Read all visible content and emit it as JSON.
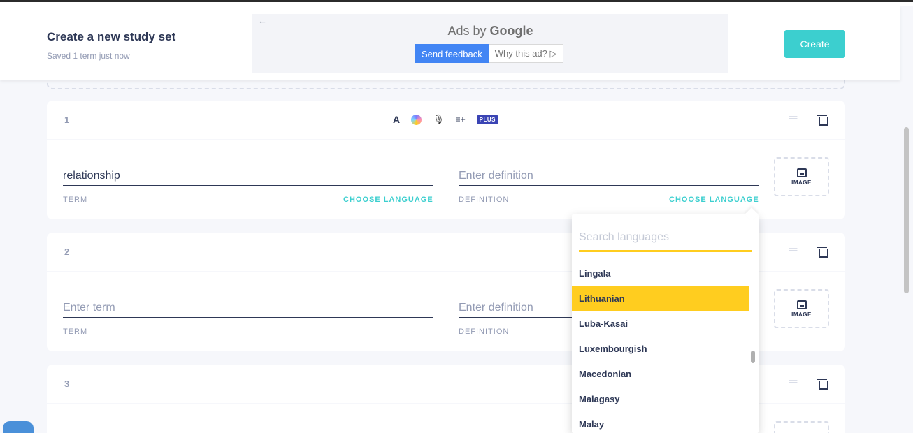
{
  "header": {
    "title": "Create a new study set",
    "saved_status": "Saved 1 term just now",
    "create_label": "Create"
  },
  "ad": {
    "back_arrow": "←",
    "title_prefix": "Ads by ",
    "title_brand": "Google",
    "feedback_label": "Send feedback",
    "why_label": "Why this ad? ▷"
  },
  "toolbar": {
    "text_icon": "A",
    "mic_icon": "🎙",
    "list_icon": "≡+",
    "plus_badge": "PLUS"
  },
  "cards": [
    {
      "number": "1",
      "term_value": "relationship",
      "definition_placeholder": "Enter definition",
      "term_label": "TERM",
      "definition_label": "DEFINITION",
      "choose_language": "CHOOSE LANGUAGE",
      "image_label": "IMAGE"
    },
    {
      "number": "2",
      "term_placeholder": "Enter term",
      "definition_placeholder": "Enter definition",
      "term_label": "TERM",
      "definition_label": "DEFINITION",
      "image_label": "IMAGE"
    },
    {
      "number": "3"
    }
  ],
  "language_dropdown": {
    "search_placeholder": "Search languages",
    "items": [
      "Lingala",
      "Lithuanian",
      "Luba-Kasai",
      "Luxembourgish",
      "Macedonian",
      "Malagasy",
      "Malay"
    ],
    "selected": "Lithuanian"
  },
  "colors": {
    "accent": "#3ccfcf",
    "highlight": "#ffcd1f",
    "plus_badge": "#3a44b4",
    "ad_button": "#4285f4"
  }
}
